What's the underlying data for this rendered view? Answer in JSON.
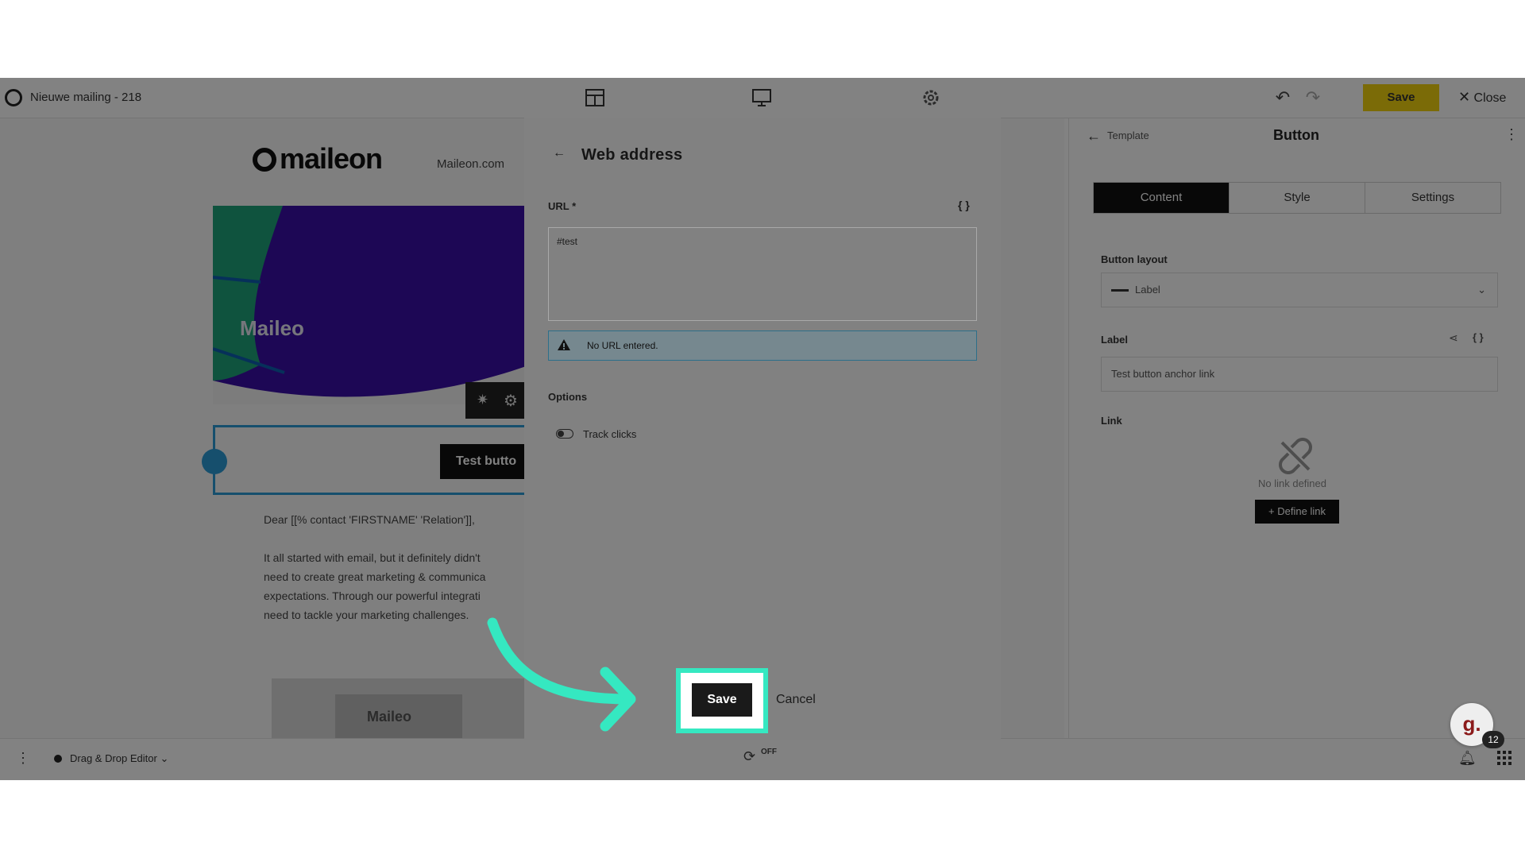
{
  "topbar": {
    "title": "Nieuwe mailing - 218",
    "save_label": "Save",
    "close_label": "Close"
  },
  "canvas": {
    "brand": "maileon",
    "brand_link": "Maileon.com",
    "hero_text": "Maileo",
    "test_button": "Test butto",
    "greeting": "Dear [[% contact 'FIRSTNAME' 'Relation']],",
    "paragraph": [
      "It all started with email, but it definitely didn't",
      "need to create great marketing & communica",
      "expectations. Through our powerful integrati",
      "need to tackle your marketing challenges."
    ]
  },
  "right_panel": {
    "breadcrumb": "Template",
    "title": "Button",
    "tabs": [
      "Content",
      "Style",
      "Settings"
    ],
    "active_tab": "Content",
    "button_layout_label": "Button layout",
    "button_layout_value": "Label",
    "label_label": "Label",
    "label_value": "Test button anchor link",
    "link_label": "Link",
    "no_link_text": "No link defined",
    "define_link": "+ Define link"
  },
  "bottombar": {
    "editor_label": "Drag & Drop Editor",
    "toggle_text": "OFF"
  },
  "modal": {
    "title": "Web address",
    "url_label": "URL *",
    "url_value": "#test",
    "warning": "No URL entered.",
    "options_label": "Options",
    "track_clicks_label": "Track clicks",
    "track_clicks_on": false,
    "save_label": "Save",
    "cancel_label": "Cancel"
  },
  "chat": {
    "icon_text": "g.",
    "badge_count": "12"
  },
  "colors": {
    "highlight": "#35e8c1",
    "accent_yellow": "#f2d20e",
    "selection_blue": "#2c9bd6"
  }
}
